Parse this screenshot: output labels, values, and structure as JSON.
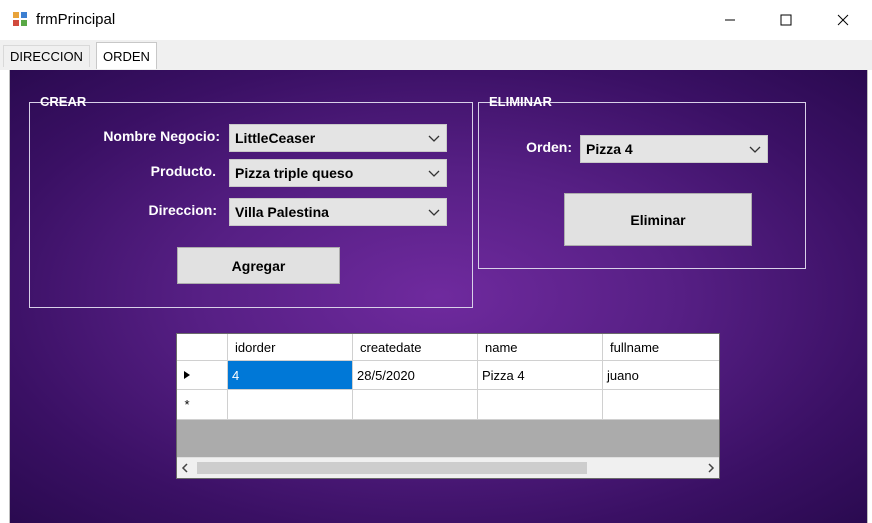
{
  "window": {
    "title": "frmPrincipal",
    "minimize_icon": "minimize-icon",
    "maximize_icon": "maximize-icon",
    "close_icon": "close-icon"
  },
  "tabs": [
    {
      "label": "DIRECCION",
      "active": false
    },
    {
      "label": "ORDEN",
      "active": true
    }
  ],
  "crear": {
    "title": "CREAR",
    "negocio_label": "Nombre Negocio:",
    "negocio_value": "LittleCeaser",
    "producto_label": "Producto.",
    "producto_value": "Pizza triple queso",
    "direccion_label": "Direccion:",
    "direccion_value": "Villa Palestina",
    "add_button": "Agregar"
  },
  "eliminar": {
    "title": "ELIMINAR",
    "orden_label": "Orden:",
    "orden_value": "Pizza 4",
    "delete_button": "Eliminar"
  },
  "grid": {
    "columns": [
      "idorder",
      "createdate",
      "name",
      "fullname"
    ],
    "rows": [
      [
        "4",
        "28/5/2020",
        "Pizza 4",
        "juano"
      ]
    ],
    "selected_cell": {
      "row": 0,
      "col": 0
    }
  },
  "colors": {
    "panel_bg": "#561f84",
    "selection": "#0078d7"
  }
}
